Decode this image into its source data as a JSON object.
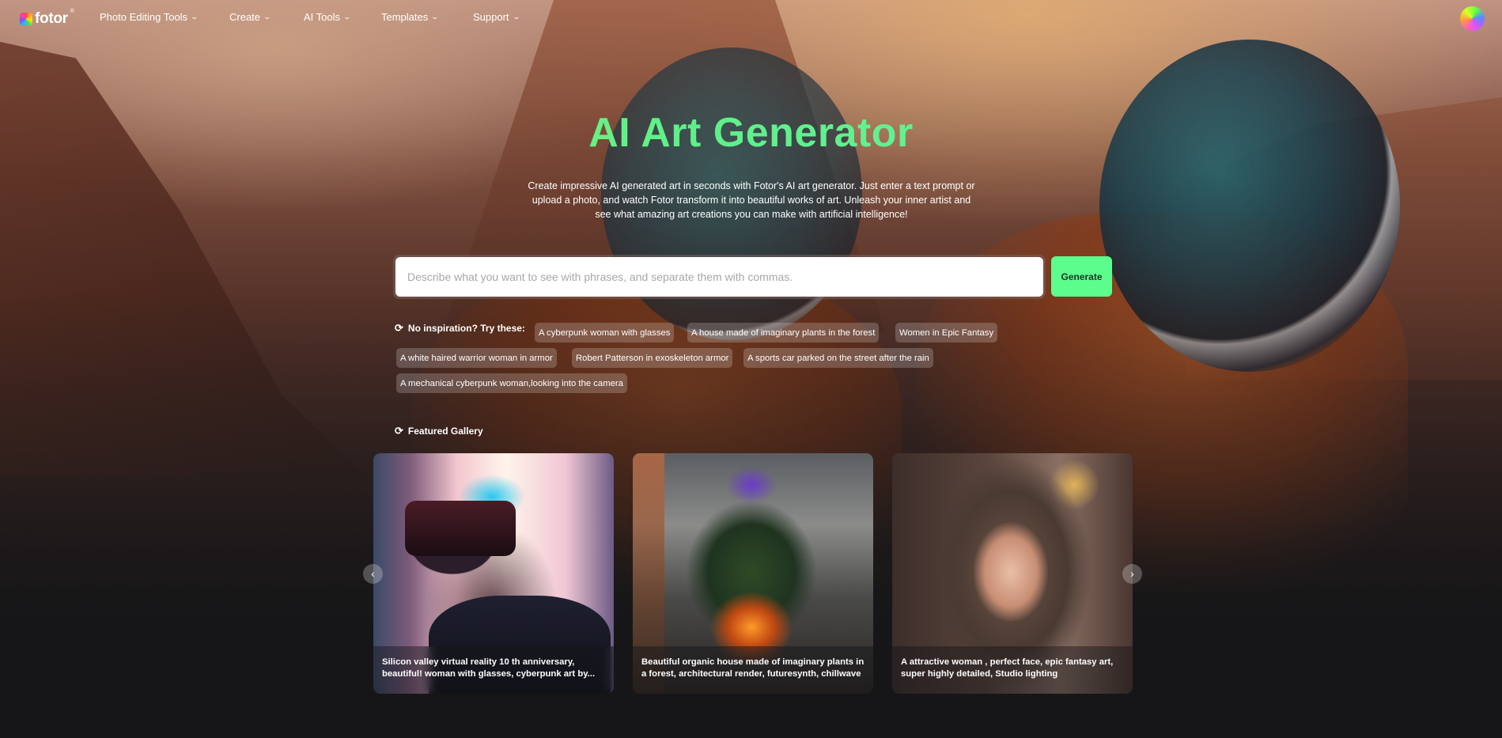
{
  "nav": {
    "logo_text": "fotor",
    "logo_reg": "®",
    "items": [
      {
        "label": "Photo Editing Tools"
      },
      {
        "label": "Create"
      },
      {
        "label": "AI Tools"
      },
      {
        "label": "Templates"
      },
      {
        "label": "Support"
      }
    ],
    "chevron_icon": "chevron-down-icon",
    "chevron_glyph": "⌄"
  },
  "hero": {
    "title": "AI Art Generator",
    "subtitle": "Create impressive AI generated art in seconds with Fotor's AI art generator. Just enter a text prompt or upload a photo, and watch Fotor transform it into beautiful works of art. Unleash your inner artist and see what amazing art creations you can make with artificial intelligence!",
    "prompt_placeholder": "Describe what you want to see with phrases, and separate them with commas.",
    "prompt_value": "",
    "generate_label": "Generate"
  },
  "inspiration": {
    "label": "No inspiration? Try these:",
    "refresh_glyph": "⟳",
    "chips": [
      "A cyberpunk woman with glasses",
      "A house made of imaginary plants in the forest",
      "Women in Epic Fantasy",
      "A white haired warrior woman in armor",
      "Robert Patterson in exoskeleton armor",
      "A sports car parked on the street after the rain",
      "A mechanical cyberpunk woman,looking into the camera"
    ]
  },
  "gallery": {
    "label": "Featured Gallery",
    "prev_glyph": "‹",
    "next_glyph": "›",
    "cards": [
      {
        "caption": "Silicon valley virtual reality 10 th anniversary, beautiful! woman with glasses, cyberpunk art by..."
      },
      {
        "caption": "Beautiful organic house made of imaginary plants in a forest, architectural render, futuresynth, chillwave"
      },
      {
        "caption": "A attractive woman , perfect face, epic fantasy art, super highly detailed, Studio lighting"
      }
    ]
  },
  "colors": {
    "accent_green": "#5cfd8d",
    "title_gradient_start": "#a4f26a",
    "title_gradient_end": "#6cf3a0",
    "page_bg": "#161618"
  }
}
